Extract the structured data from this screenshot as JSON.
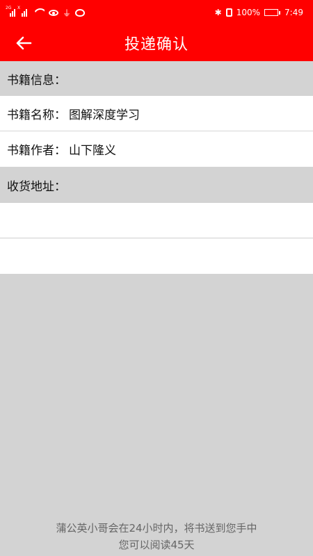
{
  "status_bar": {
    "left_signal_1_tag": "2G",
    "left_signal_2_tag": "X",
    "battery_text": "100%",
    "time": "7:49"
  },
  "header": {
    "title": "投递确认",
    "back_icon": "arrow-left-icon",
    "bg_color": "#ff0000"
  },
  "book_info": {
    "section_label": "书籍信息：",
    "name_label": "书籍名称：",
    "name_value": "图解深度学习",
    "author_label": "书籍作者：",
    "author_value": "山下隆义"
  },
  "address": {
    "section_label": "收货地址：",
    "input1_placeholder": "",
    "input2_placeholder": ""
  },
  "footer": {
    "line1": "蒲公英小哥会在24小时内，将书送到您手中",
    "line2": "您可以阅读45天"
  }
}
